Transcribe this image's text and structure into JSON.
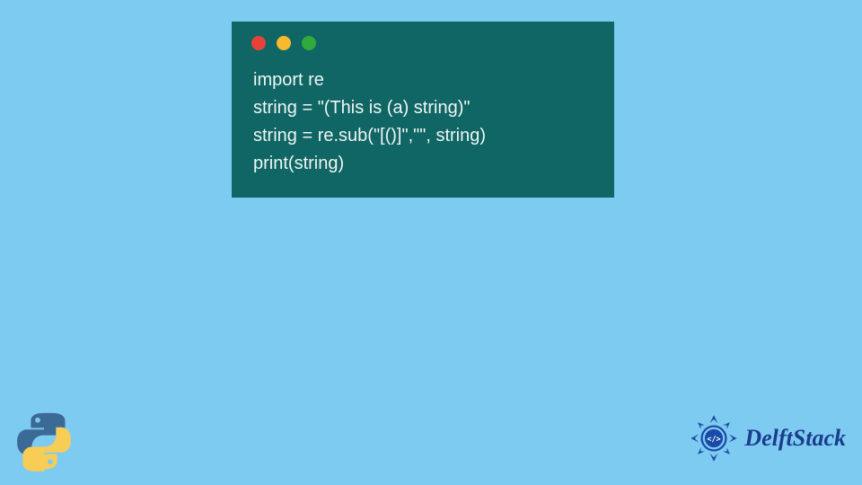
{
  "window": {
    "traffic_lights": {
      "red": "#e74237",
      "yellow": "#f7b92e",
      "green": "#2faa3b"
    },
    "code_lines": [
      "import re",
      "string = \"(This is (a) string)\"",
      "string = re.sub(\"[()]\",\"\", string)",
      "print(string)"
    ]
  },
  "language": "Python",
  "brand": {
    "name": "DelftStack"
  },
  "colors": {
    "page_bg": "#7ecbf1",
    "window_bg": "#0f6665",
    "code_text": "#eef6f4",
    "brand_text": "#1a3d8f"
  }
}
